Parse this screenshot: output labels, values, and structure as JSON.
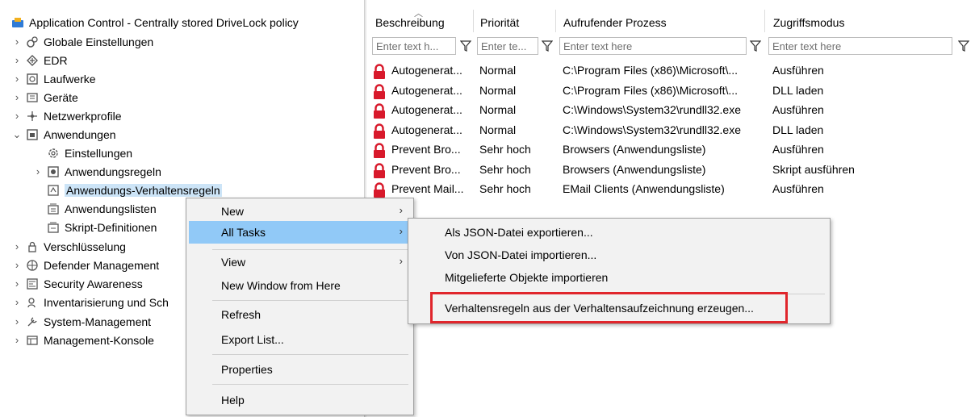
{
  "tree": {
    "root_label": "Application Control - Centrally stored DriveLock policy",
    "items": [
      {
        "label": "Globale Einstellungen"
      },
      {
        "label": "EDR"
      },
      {
        "label": "Laufwerke"
      },
      {
        "label": "Geräte"
      },
      {
        "label": "Netzwerkprofile"
      },
      {
        "label": "Anwendungen"
      },
      {
        "label": "Einstellungen"
      },
      {
        "label": "Anwendungsregeln"
      },
      {
        "label": "Anwendungs-Verhaltensregeln"
      },
      {
        "label": "Anwendungslisten"
      },
      {
        "label": "Skript-Definitionen"
      },
      {
        "label": "Verschlüsselung"
      },
      {
        "label": "Defender Management"
      },
      {
        "label": "Security Awareness"
      },
      {
        "label": "Inventarisierung und Sch"
      },
      {
        "label": "System-Management"
      },
      {
        "label": "Management-Konsole"
      }
    ]
  },
  "list": {
    "columns": [
      "Beschreibung",
      "Priorität",
      "Aufrufender Prozess",
      "Zugriffsmodus"
    ],
    "filters": [
      "Enter text h...",
      "Enter te...",
      "Enter text here",
      "Enter text here"
    ],
    "rows": [
      [
        "Autogenerat...",
        "Normal",
        "C:\\Program Files (x86)\\Microsoft\\...",
        "Ausführen"
      ],
      [
        "Autogenerat...",
        "Normal",
        "C:\\Program Files (x86)\\Microsoft\\...",
        "DLL laden"
      ],
      [
        "Autogenerat...",
        "Normal",
        "C:\\Windows\\System32\\rundll32.exe",
        "Ausführen"
      ],
      [
        "Autogenerat...",
        "Normal",
        "C:\\Windows\\System32\\rundll32.exe",
        "DLL laden"
      ],
      [
        "Prevent Bro...",
        "Sehr hoch",
        "Browsers (Anwendungsliste)",
        "Ausführen"
      ],
      [
        "Prevent Bro...",
        "Sehr hoch",
        "Browsers (Anwendungsliste)",
        "Skript ausführen"
      ],
      [
        "Prevent Mail...",
        "Sehr hoch",
        "EMail Clients (Anwendungsliste)",
        "Ausführen"
      ]
    ]
  },
  "context_menu": {
    "items": [
      {
        "label": "New"
      },
      {
        "label": "All Tasks"
      },
      {
        "label": "View"
      },
      {
        "label": "New Window from Here"
      },
      {
        "label": "Refresh"
      },
      {
        "label": "Export List..."
      },
      {
        "label": "Properties"
      },
      {
        "label": "Help"
      }
    ]
  },
  "submenu": {
    "items": [
      {
        "label": "Als JSON-Datei exportieren..."
      },
      {
        "label": "Von JSON-Datei importieren..."
      },
      {
        "label": "Mitgelieferte Objekte importieren"
      },
      {
        "label": "Verhaltensregeln aus der Verhaltensaufzeichnung erzeugen..."
      }
    ]
  },
  "colors": {
    "highlight": "#91c9f7",
    "selection": "#cce4f7",
    "callout": "#e0262c",
    "lock_red": "#d8192b"
  }
}
